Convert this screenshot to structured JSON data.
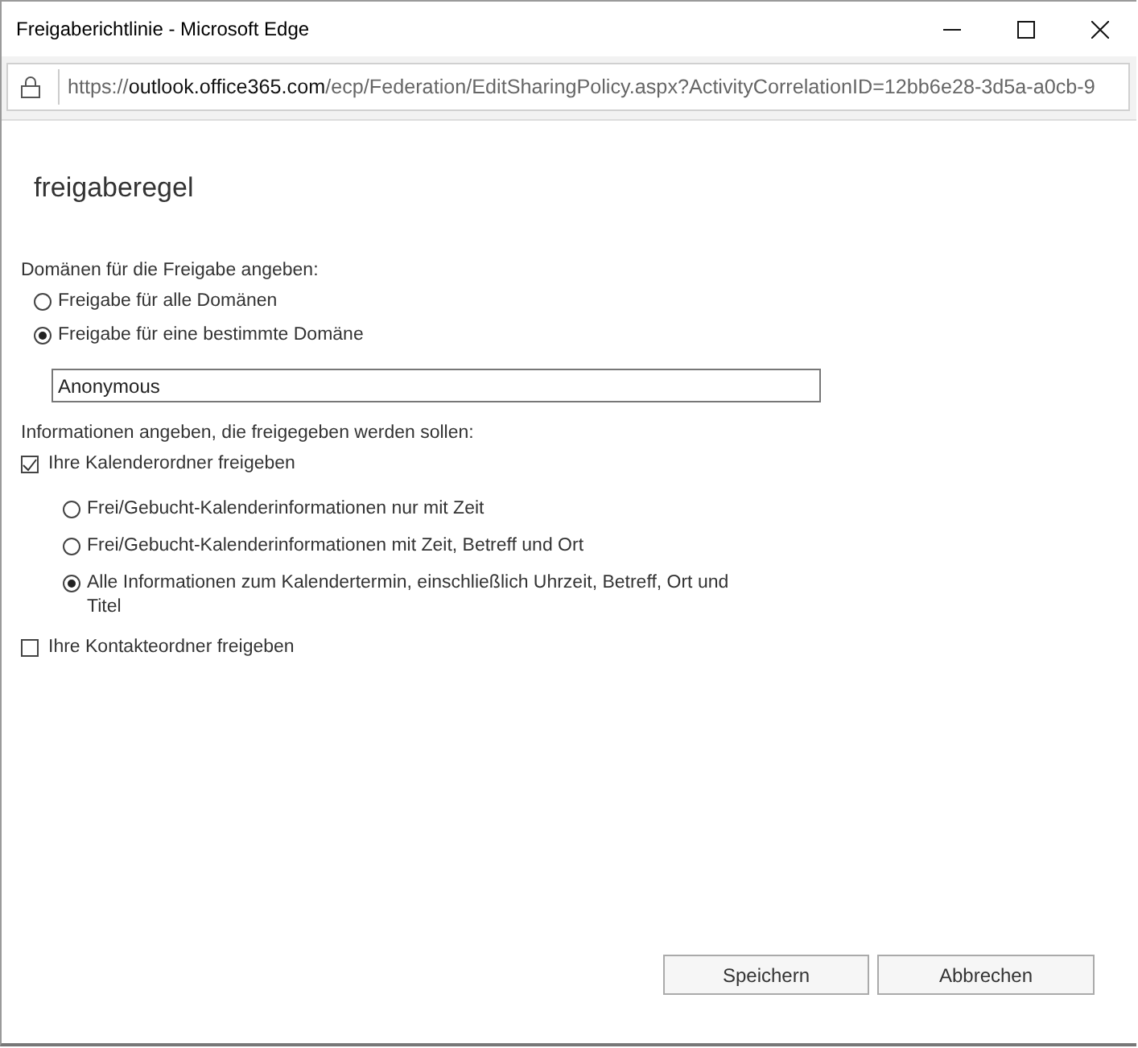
{
  "window": {
    "title": "Freigaberichtlinie - Microsoft Edge"
  },
  "address_bar": {
    "scheme": "https://",
    "host": "outlook.office365.com",
    "path": "/ecp/Federation/EditSharingPolicy.aspx?ActivityCorrelationID=12bb6e28-3d5a-a0cb-9"
  },
  "heading": "freigaberegel",
  "domains": {
    "label": "Domänen für die Freigabe angeben:",
    "options": [
      {
        "label": "Freigabe für alle Domänen",
        "selected": false
      },
      {
        "label": "Freigabe für eine bestimmte Domäne",
        "selected": true
      }
    ],
    "field": {
      "value": "Anonymous"
    }
  },
  "info": {
    "label": "Informationen angeben, die freigegeben werden sollen:",
    "items": [
      {
        "label": "Ihre Kalenderordner freigeben",
        "checked": true,
        "options": [
          {
            "label": "Frei/Gebucht-Kalenderinformationen nur mit Zeit",
            "selected": false
          },
          {
            "label": "Frei/Gebucht-Kalenderinformationen mit Zeit, Betreff und Ort",
            "selected": false
          },
          {
            "label": "Alle Informationen zum Kalendertermin, einschließlich Uhrzeit, Betreff, Ort und Titel",
            "selected": true
          }
        ]
      },
      {
        "label": "Ihre Kontakteordner freigeben",
        "checked": false
      }
    ]
  },
  "buttons": [
    "Speichern",
    "Abbrechen"
  ]
}
